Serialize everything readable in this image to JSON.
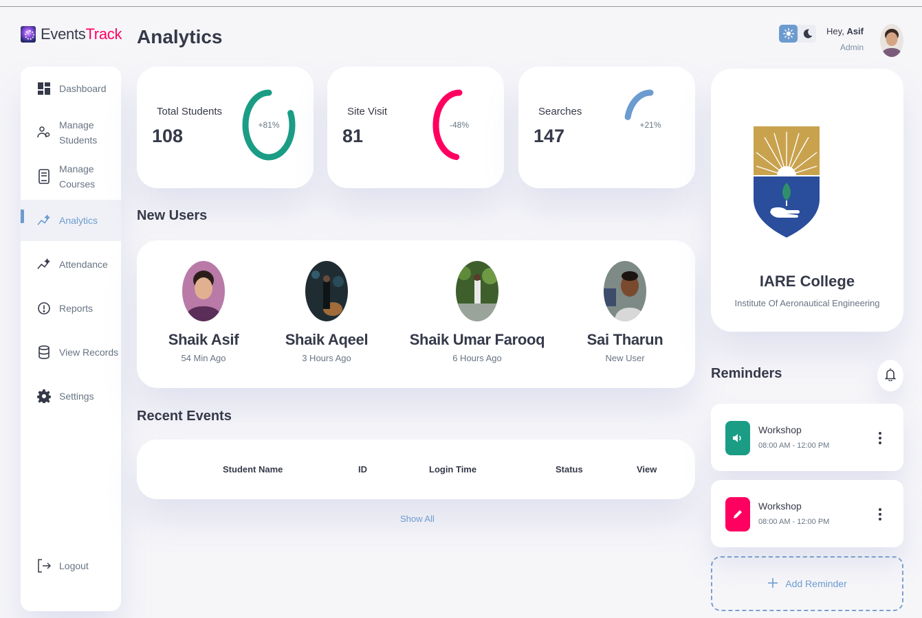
{
  "brand": {
    "name_part1": "Events",
    "name_part2": "Track"
  },
  "page": {
    "title": "Analytics"
  },
  "header": {
    "greeting": "Hey,",
    "user_name": "Asif",
    "user_role": "Admin"
  },
  "sidebar": {
    "items": [
      {
        "label": "Dashboard",
        "icon": "grid-icon",
        "active": false
      },
      {
        "label_line1": "Manage",
        "label_line2": "Students",
        "icon": "users-icon",
        "active": false
      },
      {
        "label_line1": "Manage",
        "label_line2": "Courses",
        "icon": "book-icon",
        "active": false
      },
      {
        "label": "Analytics",
        "icon": "analytics-icon",
        "active": true
      },
      {
        "label": "Attendance",
        "icon": "attendance-icon",
        "active": false
      },
      {
        "label": "Reports",
        "icon": "report-icon",
        "active": false
      },
      {
        "label": "View Records",
        "icon": "database-icon",
        "active": false
      },
      {
        "label": "Settings",
        "icon": "gear-icon",
        "active": false
      }
    ],
    "logout": "Logout"
  },
  "stats": [
    {
      "label": "Total Students",
      "value": "108",
      "change": "+81%",
      "ring_percent": 81,
      "color": "#1b9c85"
    },
    {
      "label": "Site Visit",
      "value": "81",
      "change": "-48%",
      "ring_percent": 48,
      "color": "#ff0060"
    },
    {
      "label": "Searches",
      "value": "147",
      "change": "+21%",
      "ring_percent": 21,
      "color": "#6c9bcf"
    }
  ],
  "new_users": {
    "title": "New Users",
    "users": [
      {
        "name": "Shaik Asif",
        "time": "54 Min Ago"
      },
      {
        "name": "Shaik Aqeel",
        "time": "3 Hours Ago"
      },
      {
        "name": "Shaik Umar Farooq",
        "time": "6 Hours Ago"
      },
      {
        "name": "Sai Tharun",
        "time": "New User"
      }
    ]
  },
  "recent_events": {
    "title": "Recent Events",
    "columns": [
      "Student Name",
      "ID",
      "Login Time",
      "Status",
      "View"
    ],
    "show_all": "Show All"
  },
  "college": {
    "name": "IARE College",
    "subtitle": "Institute Of Aeronautical Engineering"
  },
  "reminders": {
    "title": "Reminders",
    "items": [
      {
        "name": "Workshop",
        "time": "08:00 AM - 12:00 PM",
        "icon": "volume-icon",
        "color": "#1b9c85"
      },
      {
        "name": "Workshop",
        "time": "08:00 AM - 12:00 PM",
        "icon": "pencil-icon",
        "color": "#ff0060"
      }
    ],
    "add_label": "Add Reminder"
  },
  "colors": {
    "primary": "#6c9bcf",
    "danger": "#ff0060",
    "success": "#1b9c85",
    "background": "#f6f6f9"
  }
}
